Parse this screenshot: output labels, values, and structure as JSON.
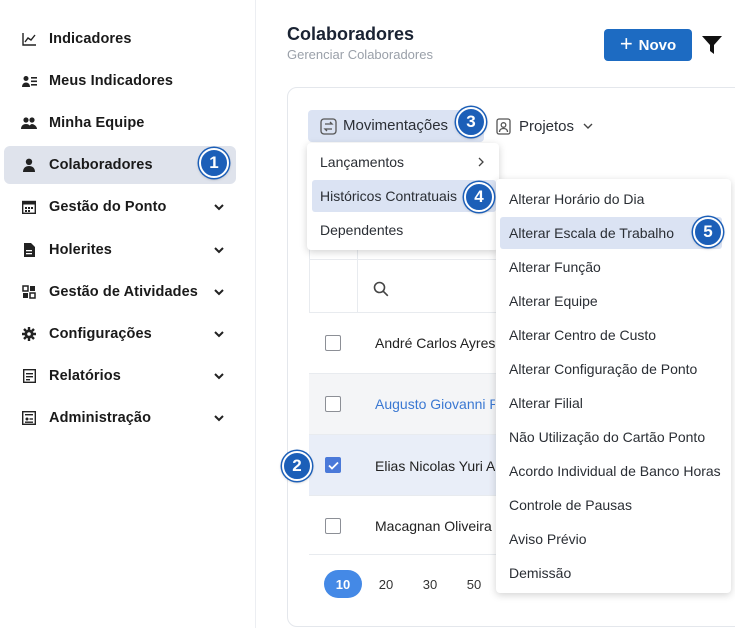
{
  "sidebar": {
    "items": [
      {
        "label": "Indicadores",
        "icon": "chart-line-icon",
        "expandable": false
      },
      {
        "label": "Meus Indicadores",
        "icon": "user-list-icon",
        "expandable": false
      },
      {
        "label": "Minha Equipe",
        "icon": "users-icon",
        "expandable": false
      },
      {
        "label": "Colaboradores",
        "icon": "user-icon",
        "expandable": false,
        "active": true
      },
      {
        "label": "Gestão do Ponto",
        "icon": "calendar-icon",
        "expandable": true
      },
      {
        "label": "Holerites",
        "icon": "document-icon",
        "expandable": true
      },
      {
        "label": "Gestão de Atividades",
        "icon": "grid-icon",
        "expandable": true
      },
      {
        "label": "Configurações",
        "icon": "gear-icon",
        "expandable": true
      },
      {
        "label": "Relatórios",
        "icon": "report-icon",
        "expandable": true
      },
      {
        "label": "Administração",
        "icon": "admin-icon",
        "expandable": true
      }
    ]
  },
  "header": {
    "title": "Colaboradores",
    "subtitle": "Gerenciar Colaboradores",
    "new_button": "Novo"
  },
  "toolbar": {
    "movimentacoes_label": "Movimentações",
    "projetos_label": "Projetos"
  },
  "table": {
    "rows": [
      {
        "name": "André Carlos Ayres",
        "checked": false,
        "link": false
      },
      {
        "name": "Augusto Giovanni Po",
        "checked": false,
        "link": true
      },
      {
        "name": "Elias Nicolas Yuri Alr",
        "checked": true,
        "link": false
      },
      {
        "name": "Macagnan Oliveira",
        "checked": false,
        "link": false
      }
    ],
    "page_sizes": [
      "10",
      "20",
      "30",
      "50"
    ],
    "active_page_size": "10"
  },
  "menu_movimentacoes": {
    "items": [
      {
        "label": "Lançamentos",
        "has_submenu": true
      },
      {
        "label": "Históricos Contratuais",
        "has_submenu": true,
        "highlighted": true
      },
      {
        "label": "Dependentes",
        "has_submenu": false
      }
    ]
  },
  "menu_historicos": {
    "items": [
      {
        "label": "Alterar Horário do Dia"
      },
      {
        "label": "Alterar Escala de Trabalho",
        "highlighted": true
      },
      {
        "label": "Alterar Função"
      },
      {
        "label": "Alterar Equipe"
      },
      {
        "label": "Alterar Centro de Custo"
      },
      {
        "label": "Alterar Configuração de Ponto"
      },
      {
        "label": "Alterar Filial"
      },
      {
        "label": "Não Utilização do Cartão Ponto"
      },
      {
        "label": "Acordo Individual de Banco Horas"
      },
      {
        "label": "Controle de Pausas"
      },
      {
        "label": "Aviso Prévio"
      },
      {
        "label": "Demissão"
      }
    ]
  },
  "step_badges": [
    "1",
    "2",
    "3",
    "4",
    "5"
  ],
  "colors": {
    "primary": "#1d6bc2",
    "badge": "#1c5fb8",
    "highlight": "#dbe3f3",
    "link": "#3a78d2"
  }
}
